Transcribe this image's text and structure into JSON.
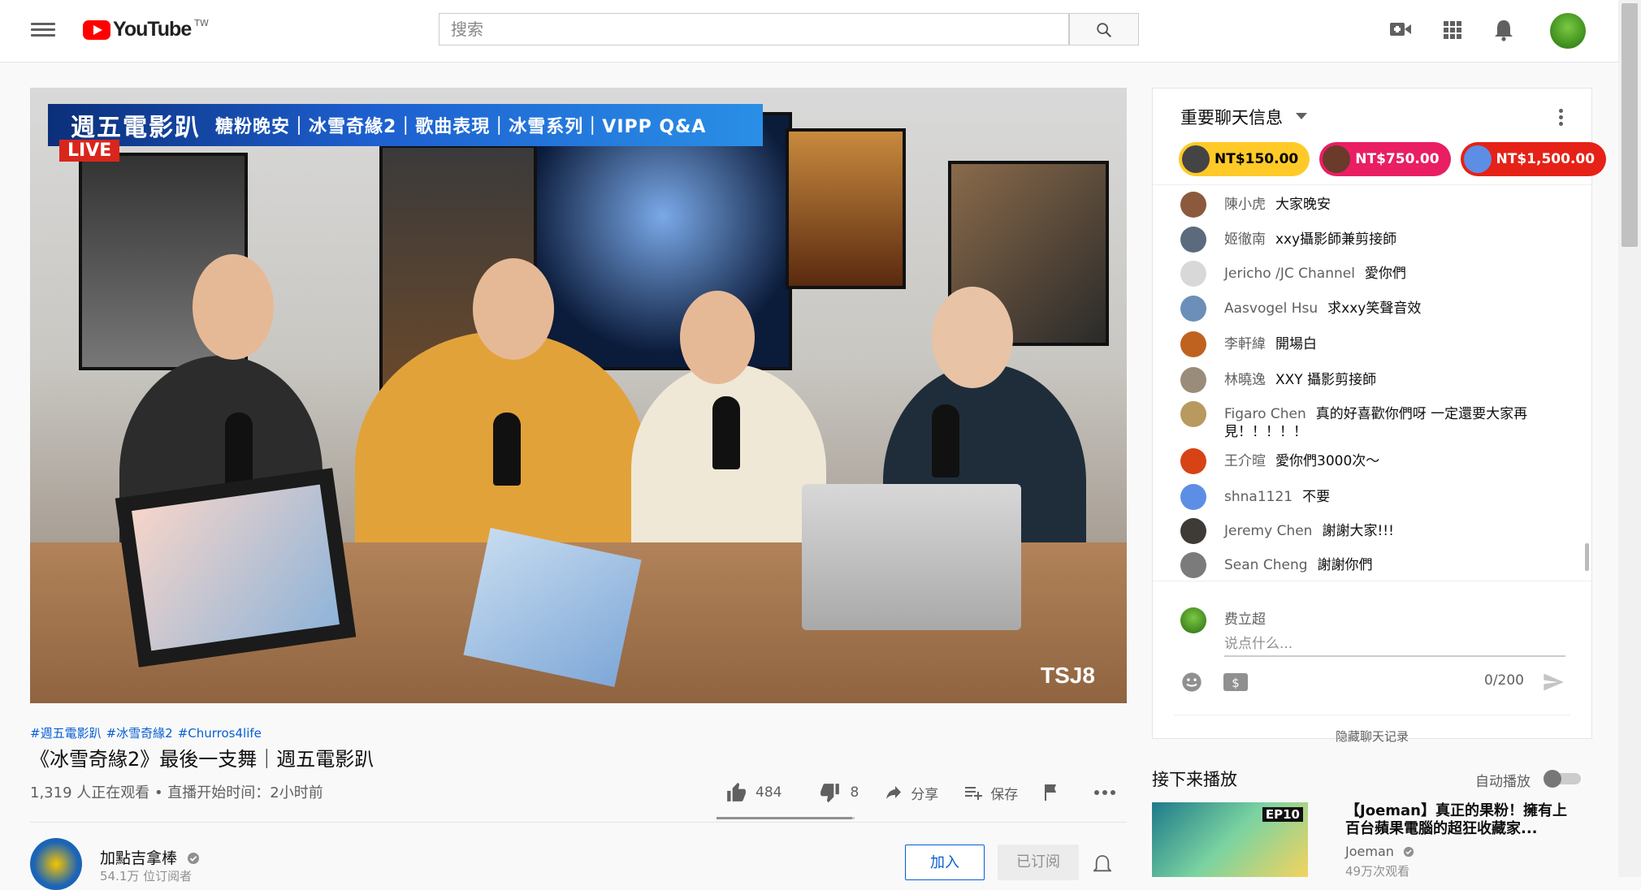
{
  "header": {
    "logo_text": "YouTube",
    "region": "TW",
    "search_placeholder": "搜索"
  },
  "video": {
    "banner_title": "週五電影趴",
    "banner_topics": "糖粉晚安｜冰雪奇緣2｜歌曲表現｜冰雪系列｜VIPP Q&A",
    "live_badge": "LIVE",
    "watermark": "TSJ8"
  },
  "video_info": {
    "hashtags": [
      "#週五電影趴",
      "#冰雪奇緣2",
      "#Churros4life"
    ],
    "title": "《冰雪奇緣2》最後一支舞｜週五電影趴",
    "meta": "1,319 人正在观看 • 直播开始时间：2小时前",
    "likes": "484",
    "dislikes": "8",
    "like_ratio": 0.984,
    "share_label": "分享",
    "save_label": "保存"
  },
  "channel": {
    "name": "加點吉拿棒",
    "subscribers": "54.1万 位订阅者",
    "join_label": "加入",
    "subscribed_label": "已订阅"
  },
  "chat": {
    "title": "重要聊天信息",
    "superchats": [
      {
        "amount": "NT$150.00",
        "color": "#ffca28",
        "text_color": "#000000"
      },
      {
        "amount": "NT$750.00",
        "color": "#e91e63",
        "text_color": "#ffffff"
      },
      {
        "amount": "NT$1,500.00",
        "color": "#e62117",
        "text_color": "#ffffff"
      }
    ],
    "messages": [
      {
        "author": "陳小虎",
        "text": "大家晚安",
        "avatar_color": "#8b5a3c"
      },
      {
        "author": "姬徹南",
        "text": "xxy攝影師兼剪接師",
        "avatar_color": "#5b6b7d"
      },
      {
        "author": "Jericho /JC Channel",
        "text": "愛你們",
        "avatar_color": "#d8d8d8"
      },
      {
        "author": "Aasvogel Hsu",
        "text": "求xxy笑聲音效",
        "avatar_color": "#6b8fb8"
      },
      {
        "author": "李軒緯",
        "text": "開場白",
        "avatar_color": "#c0621f"
      },
      {
        "author": "林曉逸",
        "text": "XXY 攝影剪接師",
        "avatar_color": "#9a8c7a"
      },
      {
        "author": "Figaro Chen",
        "text": "真的好喜歡你們呀 一定還要大家再見！！！！！",
        "avatar_color": "#b89a60"
      },
      {
        "author": "王介暄",
        "text": "愛你們3000次～",
        "avatar_color": "#d84315"
      },
      {
        "author": "shna1121",
        "text": "不要",
        "avatar_color": "#5c8ee6"
      },
      {
        "author": "Jeremy Chen",
        "text": "謝謝大家!!!",
        "avatar_color": "#3e3a36"
      },
      {
        "author": "Sean Cheng",
        "text": "謝謝你們",
        "avatar_color": "#7b7b7b"
      }
    ],
    "my_name": "费立超",
    "input_placeholder": "说点什么...",
    "counter": "0/200",
    "hide_label": "隐藏聊天记录"
  },
  "up_next": {
    "heading": "接下来播放",
    "autoplay_label": "自动播放",
    "autoplay_on": false,
    "item": {
      "title": "【Joeman】真正的果粉！擁有上百台蘋果電腦的超狂收藏家...",
      "channel": "Joeman",
      "views": "49万次观看",
      "badge": "EP10"
    }
  }
}
